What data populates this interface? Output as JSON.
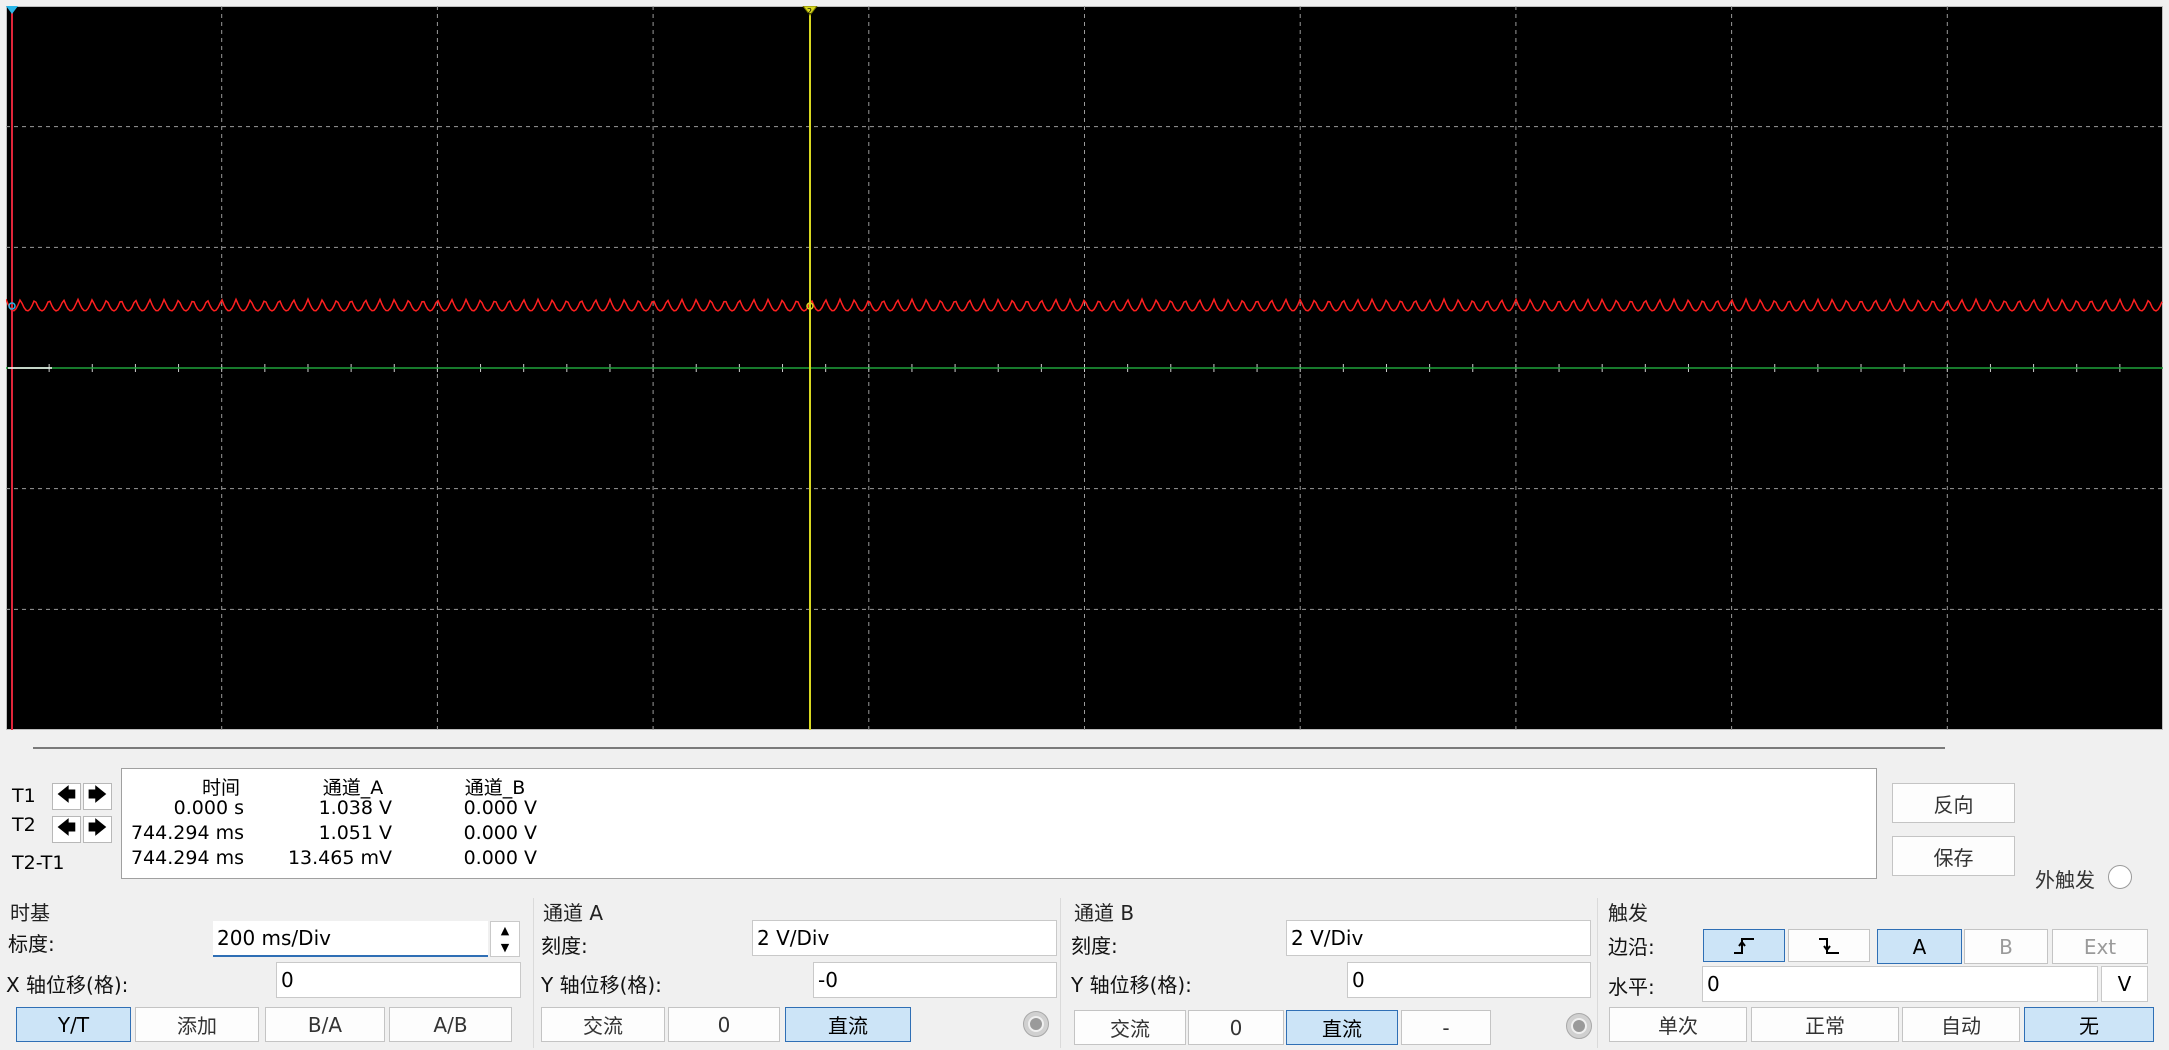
{
  "cursor_panel": {
    "t1_label": "T1",
    "t2_label": "T2",
    "t2t1_label": "T2-T1",
    "columns": [
      "时间",
      "通道_A",
      "通道_B"
    ],
    "rows": [
      {
        "time": "0.000 s",
        "a": "1.038 V",
        "b": "0.000 V"
      },
      {
        "time": "744.294 ms",
        "a": "1.051 V",
        "b": "0.000 V"
      },
      {
        "time": "744.294 ms",
        "a": "13.465 mV",
        "b": "0.000 V"
      }
    ],
    "reverse_label": "反向",
    "save_label": "保存",
    "ext_trigger_label": "外触发"
  },
  "timebase": {
    "title": "时基",
    "scale_label": "标度:",
    "scale_value": "200 ms/Div",
    "x_offset_label": "X 轴位移(格):",
    "x_offset_value": "0",
    "modes": [
      "Y/T",
      "添加",
      "B/A",
      "A/B"
    ],
    "active_mode": "Y/T"
  },
  "channel_a": {
    "title": "通道 A",
    "scale_label": "刻度:",
    "scale_value": "2  V/Div",
    "y_offset_label": "Y 轴位移(格):",
    "y_offset_value": "-0",
    "ac_label": "交流",
    "zero_label": "0",
    "dc_label": "直流",
    "coupling": "直流"
  },
  "channel_b": {
    "title": "通道 B",
    "scale_label": "刻度:",
    "scale_value": "2  V/Div",
    "y_offset_label": "Y 轴位移(格):",
    "y_offset_value": "0",
    "ac_label": "交流",
    "zero_label": "0",
    "dc_label": "直流",
    "minus_label": "-",
    "coupling": "直流"
  },
  "trigger": {
    "title": "触发",
    "edge_label": "边沿:",
    "sources": [
      "A",
      "B",
      "Ext"
    ],
    "active_source": "A",
    "level_label": "水平:",
    "level_value": "0",
    "level_unit": "V",
    "modes": [
      "单次",
      "正常",
      "自动",
      "无"
    ],
    "active_mode": "无"
  },
  "colors": {
    "screen_bg": "#000000",
    "grid": "#9a9a9a",
    "channel_a_trace": "#ff2020",
    "channel_b_trace": "#1fa33a",
    "cursor_t1": "#e0263a",
    "cursor_t2": "#d8d820",
    "accent": "#2f6fb5"
  }
}
